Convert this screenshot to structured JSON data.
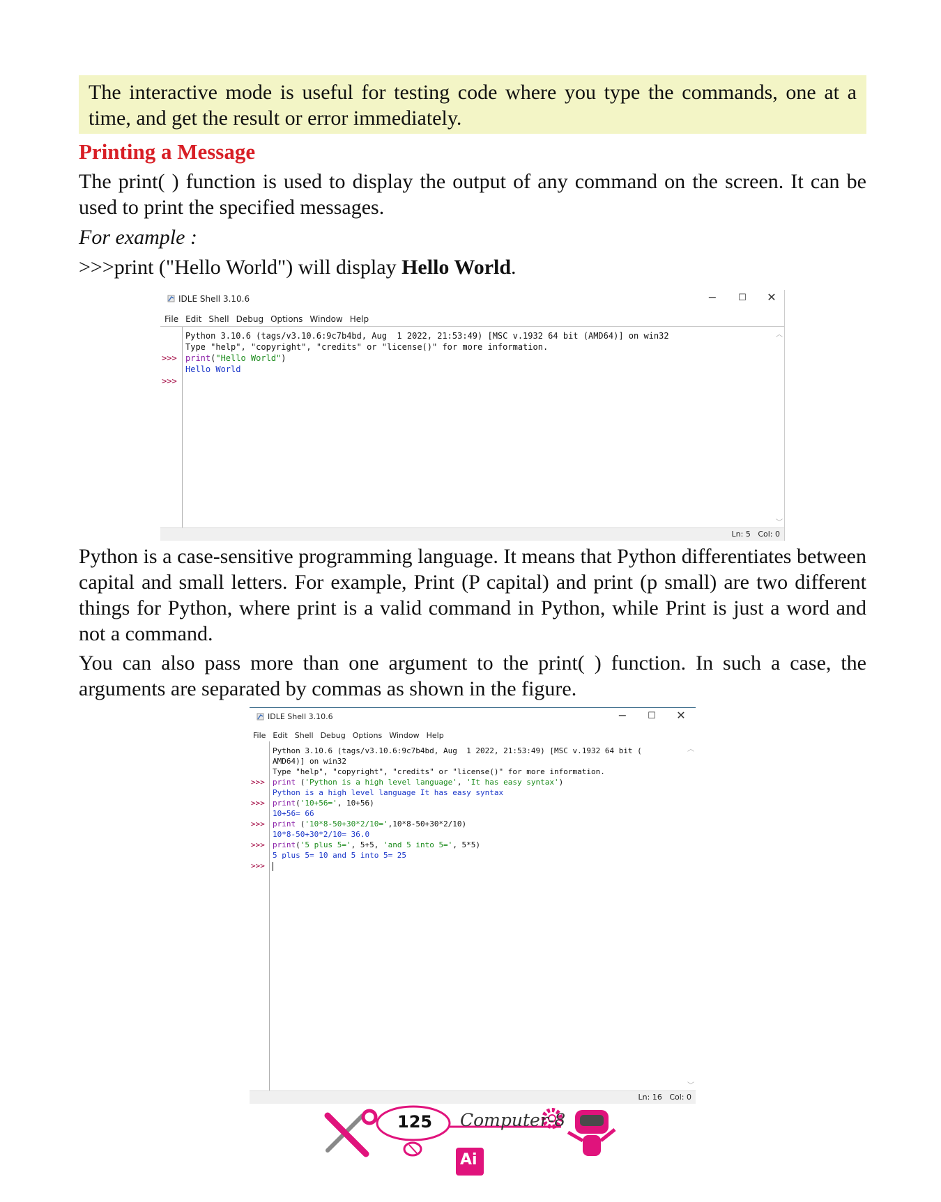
{
  "note": "The interactive mode is useful for testing code where you type the commands, one at a time, and get the result or error immediately.",
  "heading": "Printing a Message",
  "para1": "The print( ) function is used to display the output of any command on the screen. It can be used to print the specified messages.",
  "for_example": "For example :",
  "example_line": {
    "prefix": ">>>print (\"Hello World\") will display ",
    "bold": "Hello World",
    "suffix": "."
  },
  "window1": {
    "title": "IDLE Shell 3.10.6",
    "menu": [
      "File",
      "Edit",
      "Shell",
      "Debug",
      "Options",
      "Window",
      "Help"
    ],
    "controls": {
      "minimize": "−",
      "maximize": "☐",
      "close": "✕"
    },
    "header_line1": "Python 3.10.6 (tags/v3.10.6:9c7b4bd, Aug  1 2022, 21:53:49) [MSC v.1932 64 bit (AMD64)] on win32",
    "header_line2": "Type \"help\", \"copyright\", \"credits\" or \"license()\" for more information.",
    "prompt": ">>>",
    "cmd1_kw": "print",
    "cmd1_rest1": "(",
    "cmd1_str": "\"Hello World\"",
    "cmd1_rest2": ")",
    "out1": "Hello World",
    "status": "Ln: 5   Col: 0"
  },
  "para2": "Python is a case-sensitive programming language. It means that Python differentiates between capital and small letters. For example, Print (P capital) and print (p small) are two different things for Python, where print is a valid command in Python, while Print is just a word and not a command.",
  "para3": "You can also pass more than one argument to the print( ) function. In such a case, the arguments are separated by commas as shown in the figure.",
  "window2": {
    "title": "IDLE Shell 3.10.6",
    "menu": [
      "File",
      "Edit",
      "Shell",
      "Debug",
      "Options",
      "Window",
      "Help"
    ],
    "controls": {
      "minimize": "−",
      "maximize": "☐",
      "close": "✕"
    },
    "header_line1": "Python 3.10.6 (tags/v3.10.6:9c7b4bd, Aug  1 2022, 21:53:49) [MSC v.1932 64 bit (",
    "header_line2": "AMD64)] on win32",
    "header_line3": "Type \"help\", \"copyright\", \"credits\" or \"license()\" for more information.",
    "prompt": ">>>",
    "l1_kw": "print",
    "l1_a": " (",
    "l1_s1": "'Python is a high level language'",
    "l1_b": ", ",
    "l1_s2": "'It has easy syntax'",
    "l1_c": ")",
    "o1": "Python is a high level language It has easy syntax",
    "l2_kw": "print",
    "l2_a": "(",
    "l2_s1": "'10+56='",
    "l2_b": ", 10+56)",
    "o2": "10+56= 66",
    "l3_kw": "print",
    "l3_a": " (",
    "l3_s1": "'10*8-50+30*2/10='",
    "l3_b": ",10*8-50+30*2/10)",
    "o3": "10*8-50+30*2/10= 36.0",
    "l4_kw": "print",
    "l4_a": "(",
    "l4_s1": "'5 plus 5='",
    "l4_b": ", 5+5, ",
    "l4_s2": "'and 5 into 5='",
    "l4_c": ", 5*5)",
    "o4": "5 plus 5= 10 and 5 into 5= 25",
    "status": "Ln: 16   Col: 0"
  },
  "footer": {
    "page_number": "125",
    "brand": "Computer-8",
    "badge": "Ai",
    "icons": [
      "tools-icon",
      "mouse-icon",
      "gear-icon",
      "robot-icon"
    ],
    "colors": {
      "accent": "#e0137c",
      "heading": "#d81f26",
      "note_bg": "#f3f5c6"
    }
  }
}
